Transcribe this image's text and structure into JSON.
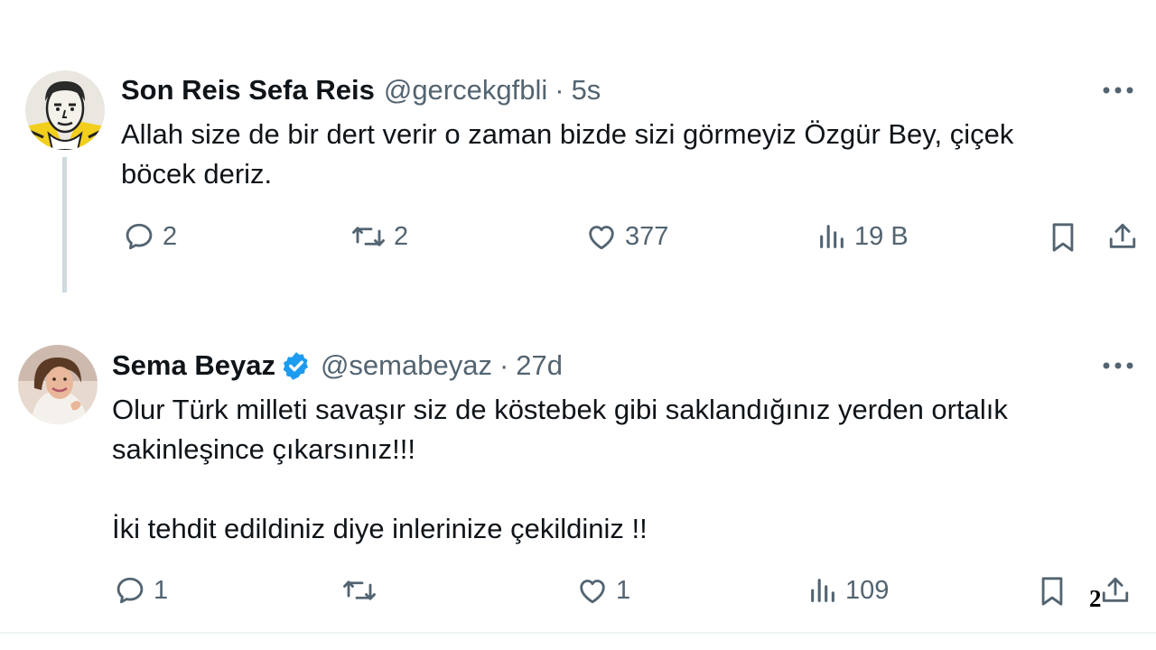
{
  "tweets": [
    {
      "name": "Son Reis Sefa Reis",
      "handle": "@gercekgfbli",
      "separator": "·",
      "time": "5s",
      "text": "Allah size de bir dert verir o zaman bizde sizi görmeyiz Özgür Bey, çiçek\nböcek deriz.",
      "replies": "2",
      "retweets": "2",
      "likes": "377",
      "views": "19 B",
      "verified": false
    },
    {
      "name": "Sema Beyaz",
      "handle": "@semabeyaz",
      "separator": "·",
      "time": "27d",
      "text": "Olur Türk milleti savaşır siz de köstebek gibi saklandığınız yerden ortalık\nsakinleşince çıkarsınız!!!\n\nİki tehdit edildiniz diye inlerinize çekildiniz !!",
      "replies": "1",
      "retweets": "",
      "likes": "1",
      "views": "109",
      "verified": true
    }
  ],
  "page_number": "2",
  "icons": [
    "more-icon",
    "reply-icon",
    "retweet-icon",
    "like-icon",
    "views-icon",
    "bookmark-icon",
    "share-icon",
    "verified-badge-icon"
  ],
  "colors": {
    "text": "#0f1419",
    "secondary": "#536471",
    "verified": "#1d9bf0",
    "thread_line": "#cfd9de"
  }
}
